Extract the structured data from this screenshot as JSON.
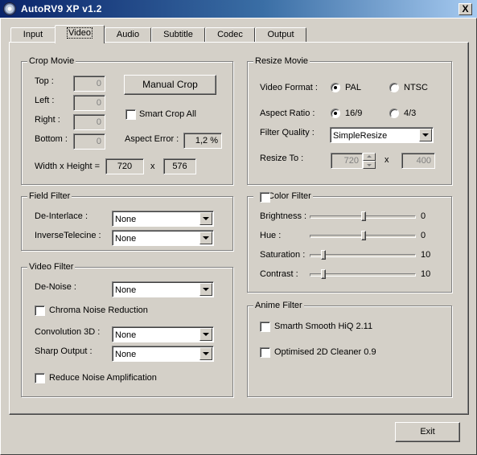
{
  "window": {
    "title": "AutoRV9  XP  v1.2",
    "close_label": "X"
  },
  "tabs": [
    {
      "label": "Input",
      "active": false
    },
    {
      "label": "Video",
      "active": true
    },
    {
      "label": "Audio",
      "active": false
    },
    {
      "label": "Subtitle",
      "active": false
    },
    {
      "label": "Codec",
      "active": false
    },
    {
      "label": "Output",
      "active": false
    }
  ],
  "crop": {
    "title": "Crop Movie",
    "top_label": "Top :",
    "top_value": "0",
    "left_label": "Left :",
    "left_value": "0",
    "right_label": "Right :",
    "right_value": "0",
    "bottom_label": "Bottom :",
    "bottom_value": "0",
    "manual_crop": "Manual Crop",
    "smart_crop_all": "Smart Crop All",
    "aspect_error_label": "Aspect Error :",
    "aspect_error_value": "1,2 %",
    "wh_label": "Width x Height =",
    "width": "720",
    "times": "x",
    "height": "576"
  },
  "field_filter": {
    "title": "Field Filter",
    "deinterlace_label": "De-Interlace :",
    "deinterlace_value": "None",
    "ivtc_label": "InverseTelecine :",
    "ivtc_value": "None"
  },
  "video_filter": {
    "title": "Video Filter",
    "denoise_label": "De-Noise :",
    "denoise_value": "None",
    "chroma_noise": "Chroma Noise Reduction",
    "conv3d_label": "Convolution 3D :",
    "conv3d_value": "None",
    "sharp_label": "Sharp Output :",
    "sharp_value": "None",
    "reduce_noise": "Reduce Noise Amplification"
  },
  "resize": {
    "title": "Resize Movie",
    "format_label": "Video Format :",
    "pal": "PAL",
    "ntsc": "NTSC",
    "aspect_label": "Aspect Ratio :",
    "ar169": "16/9",
    "ar43": "4/3",
    "filter_label": "Filter Quality :",
    "filter_value": "SimpleResize",
    "resize_label": "Resize To :",
    "resize_w": "720",
    "times": "x",
    "resize_h": "400"
  },
  "color_filter": {
    "title": "Color Filter",
    "brightness_label": "Brightness :",
    "brightness_value": "0",
    "hue_label": "Hue :",
    "hue_value": "0",
    "saturation_label": "Saturation :",
    "saturation_value": "10",
    "contrast_label": "Contrast :",
    "contrast_value": "10"
  },
  "anime_filter": {
    "title": "Anime Filter",
    "smarth": "Smarth Smooth HiQ 2.11",
    "cleaner": "Optimised 2D Cleaner 0.9"
  },
  "footer": {
    "exit_label": "Exit"
  }
}
